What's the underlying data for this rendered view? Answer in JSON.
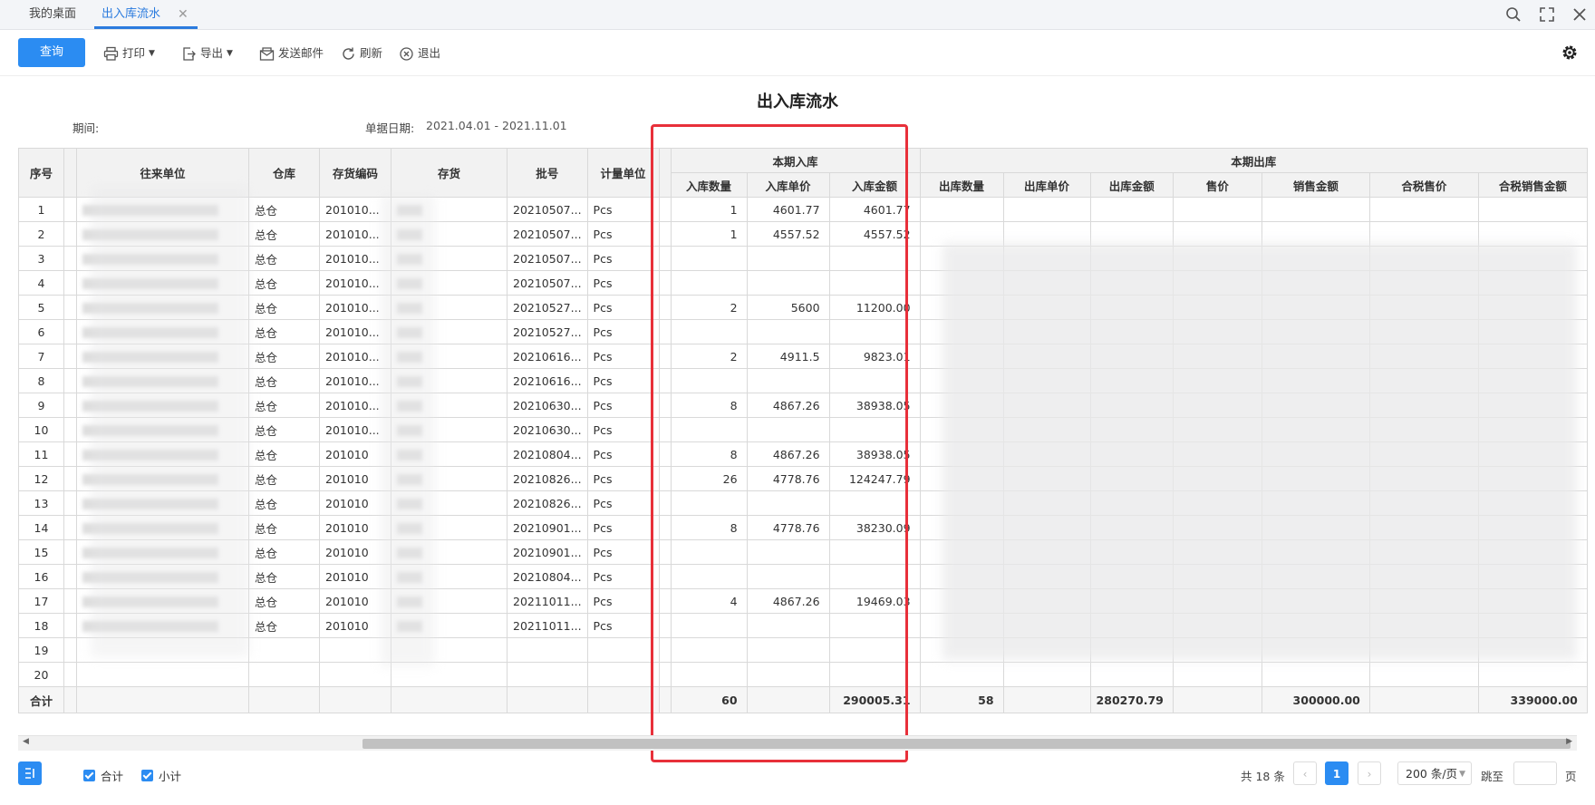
{
  "tabs": [
    {
      "label": "我的桌面"
    },
    {
      "label": "出入库流水"
    }
  ],
  "toolbar": {
    "query_label": "查询",
    "print_label": "打印",
    "export_label": "导出",
    "email_label": "发送邮件",
    "refresh_label": "刷新",
    "exit_label": "退出"
  },
  "report": {
    "title": "出入库流水",
    "period_label": "期间:",
    "doc_date_label": "单据日期:",
    "doc_date_value": "2021.04.01 - 2021.11.01"
  },
  "table": {
    "group_headers": {
      "in": "本期入库",
      "out": "本期出库"
    },
    "headers": {
      "seq": "序号",
      "partner": "往来单位",
      "warehouse": "仓库",
      "code": "存货编码",
      "item": "存货",
      "batch": "批号",
      "unit": "计量单位",
      "in_qty": "入库数量",
      "in_price": "入库单价",
      "in_amount": "入库金额",
      "out_qty": "出库数量",
      "out_price": "出库单价",
      "out_amount": "出库金额",
      "price": "售价",
      "sales_amount": "销售金额",
      "tax_price": "合税售价",
      "tax_sales_amount": "合税销售金额"
    },
    "rows": [
      {
        "seq": "1",
        "warehouse": "总仓",
        "code": "201010...",
        "batch": "20210507...",
        "unit": "Pcs",
        "in_qty": "1",
        "in_price": "4601.77",
        "in_amount": "4601.77"
      },
      {
        "seq": "2",
        "warehouse": "总仓",
        "code": "201010...",
        "batch": "20210507...",
        "unit": "Pcs",
        "in_qty": "1",
        "in_price": "4557.52",
        "in_amount": "4557.52"
      },
      {
        "seq": "3",
        "warehouse": "总仓",
        "code": "201010...",
        "batch": "20210507...",
        "unit": "Pcs",
        "in_qty": "",
        "in_price": "",
        "in_amount": ""
      },
      {
        "seq": "4",
        "warehouse": "总仓",
        "code": "201010...",
        "batch": "20210507...",
        "unit": "Pcs",
        "in_qty": "",
        "in_price": "",
        "in_amount": ""
      },
      {
        "seq": "5",
        "warehouse": "总仓",
        "code": "201010...",
        "batch": "20210527...",
        "unit": "Pcs",
        "in_qty": "2",
        "in_price": "5600",
        "in_amount": "11200.00"
      },
      {
        "seq": "6",
        "warehouse": "总仓",
        "code": "201010...",
        "batch": "20210527...",
        "unit": "Pcs",
        "in_qty": "",
        "in_price": "",
        "in_amount": ""
      },
      {
        "seq": "7",
        "warehouse": "总仓",
        "code": "201010...",
        "batch": "20210616...",
        "unit": "Pcs",
        "in_qty": "2",
        "in_price": "4911.5",
        "in_amount": "9823.01"
      },
      {
        "seq": "8",
        "warehouse": "总仓",
        "code": "201010...",
        "batch": "20210616...",
        "unit": "Pcs",
        "in_qty": "",
        "in_price": "",
        "in_amount": ""
      },
      {
        "seq": "9",
        "warehouse": "总仓",
        "code": "201010...",
        "batch": "20210630...",
        "unit": "Pcs",
        "in_qty": "8",
        "in_price": "4867.26",
        "in_amount": "38938.05"
      },
      {
        "seq": "10",
        "warehouse": "总仓",
        "code": "201010...",
        "batch": "20210630...",
        "unit": "Pcs",
        "in_qty": "",
        "in_price": "",
        "in_amount": ""
      },
      {
        "seq": "11",
        "warehouse": "总仓",
        "code": "201010",
        "batch": "20210804...",
        "unit": "Pcs",
        "in_qty": "8",
        "in_price": "4867.26",
        "in_amount": "38938.05"
      },
      {
        "seq": "12",
        "warehouse": "总仓",
        "code": "201010",
        "batch": "20210826...",
        "unit": "Pcs",
        "in_qty": "26",
        "in_price": "4778.76",
        "in_amount": "124247.79"
      },
      {
        "seq": "13",
        "warehouse": "总仓",
        "code": "201010",
        "batch": "20210826...",
        "unit": "Pcs",
        "in_qty": "",
        "in_price": "",
        "in_amount": ""
      },
      {
        "seq": "14",
        "warehouse": "总仓",
        "code": "201010",
        "batch": "20210901...",
        "unit": "Pcs",
        "in_qty": "8",
        "in_price": "4778.76",
        "in_amount": "38230.09"
      },
      {
        "seq": "15",
        "warehouse": "总仓",
        "code": "201010",
        "batch": "20210901...",
        "unit": "Pcs",
        "in_qty": "",
        "in_price": "",
        "in_amount": ""
      },
      {
        "seq": "16",
        "warehouse": "总仓",
        "code": "201010",
        "batch": "20210804...",
        "unit": "Pcs",
        "in_qty": "",
        "in_price": "",
        "in_amount": ""
      },
      {
        "seq": "17",
        "warehouse": "总仓",
        "code": "201010",
        "batch": "20211011...",
        "unit": "Pcs",
        "in_qty": "4",
        "in_price": "4867.26",
        "in_amount": "19469.03"
      },
      {
        "seq": "18",
        "warehouse": "总仓",
        "code": "201010",
        "batch": "20211011...",
        "unit": "Pcs",
        "in_qty": "",
        "in_price": "",
        "in_amount": ""
      },
      {
        "seq": "19",
        "warehouse": "",
        "code": "",
        "batch": "",
        "unit": "",
        "in_qty": "",
        "in_price": "",
        "in_amount": ""
      },
      {
        "seq": "20",
        "warehouse": "",
        "code": "",
        "batch": "",
        "unit": "",
        "in_qty": "",
        "in_price": "",
        "in_amount": ""
      }
    ],
    "totals": {
      "label": "合计",
      "in_qty": "60",
      "in_amount": "290005.31",
      "out_qty": "58",
      "out_amount": "280270.79",
      "sales_amount": "300000.00",
      "tax_sales_amount": "339000.00"
    }
  },
  "footer": {
    "total_chk_label": "合计",
    "subtotal_chk_label": "小计",
    "count_label": "共 18 条",
    "current_page": "1",
    "page_size": "200 条/页",
    "jump_label": "跳至",
    "page_suffix": "页"
  },
  "colors": {
    "accent": "#2b8cf2",
    "highlight": "#e8303a"
  }
}
